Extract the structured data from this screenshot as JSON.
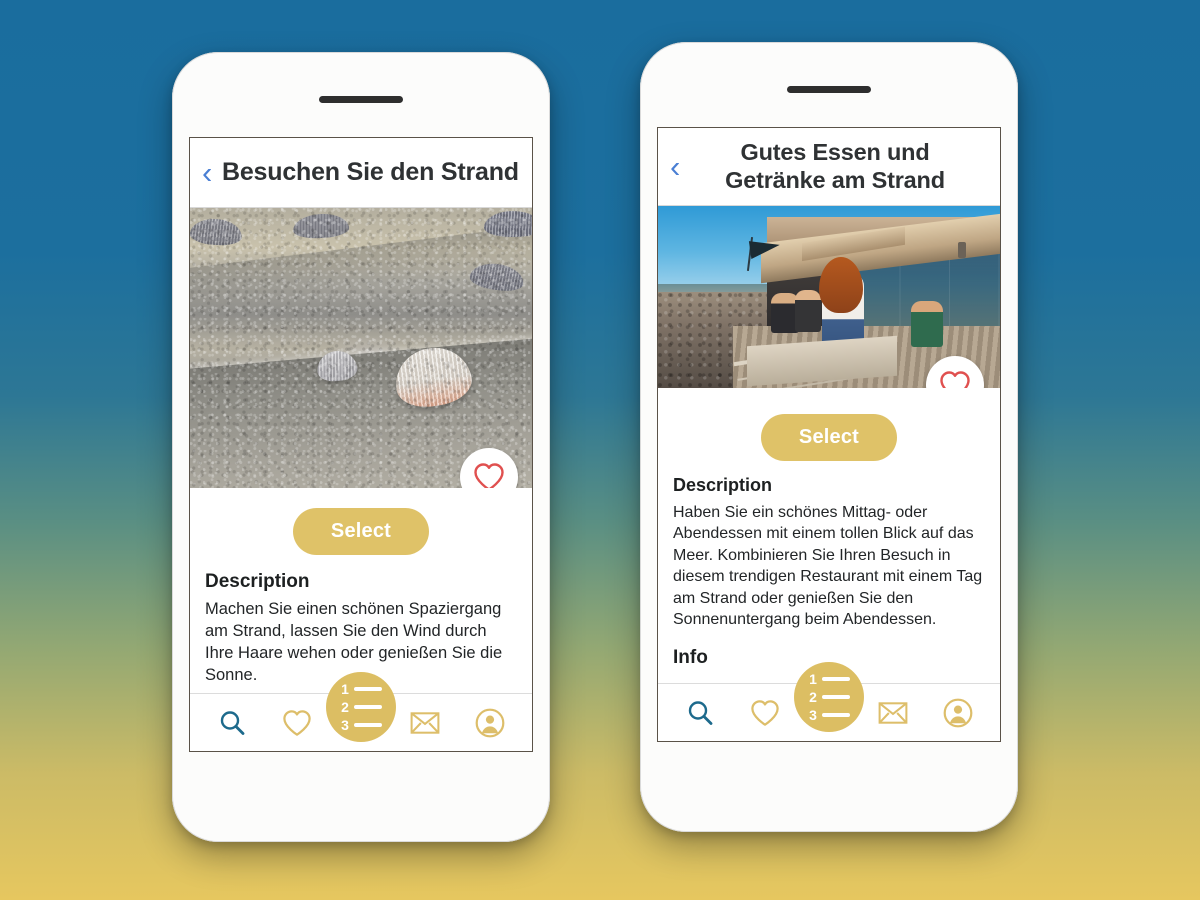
{
  "background": {
    "top_color": "#1a6d9e",
    "bottom_color": "#e6c75f"
  },
  "theme": {
    "accent_gold": "#dfc268",
    "fab_gold": "#dcbe63",
    "heart_red": "#e0504f",
    "search_blue": "#1d6a8c",
    "chevron_blue": "#4a7fd4"
  },
  "phones": [
    {
      "id": "phone-left",
      "header": {
        "back_label": "‹",
        "title": "Besuchen Sie den Strand"
      },
      "hero": {
        "image_alt": "seashells-in-sand",
        "favorite_icon": "heart-icon"
      },
      "select_label": "Select",
      "description_heading": "Description",
      "description_text": "Machen Sie einen schönen Spaziergang am Strand, lassen Sie den Wind durch Ihre Haare wehen oder genießen Sie die Sonne."
    },
    {
      "id": "phone-right",
      "header": {
        "back_label": "‹",
        "title": "Gutes Essen und Getränke am Strand"
      },
      "hero": {
        "image_alt": "beach-restaurant-terrace",
        "favorite_icon": "heart-icon"
      },
      "select_label": "Select",
      "description_heading": "Description",
      "description_text": "Haben Sie ein schönes Mittag- oder Abendessen mit einem tollen Blick auf das Meer. Kombinieren Sie Ihren Besuch in diesem trendigen Restaurant mit einem Tag am Strand oder genießen Sie den Sonnenuntergang beim Abendessen.",
      "info_heading": "Info"
    }
  ],
  "tabbar": {
    "items": [
      {
        "icon": "search-icon",
        "name": "tab-search"
      },
      {
        "icon": "heart-icon",
        "name": "tab-favorites"
      },
      {
        "icon": "envelope-icon",
        "name": "tab-messages"
      },
      {
        "icon": "account-icon",
        "name": "tab-account"
      }
    ],
    "fab": {
      "icon": "numbered-list-icon",
      "rows": [
        "1",
        "2",
        "3"
      ]
    }
  }
}
